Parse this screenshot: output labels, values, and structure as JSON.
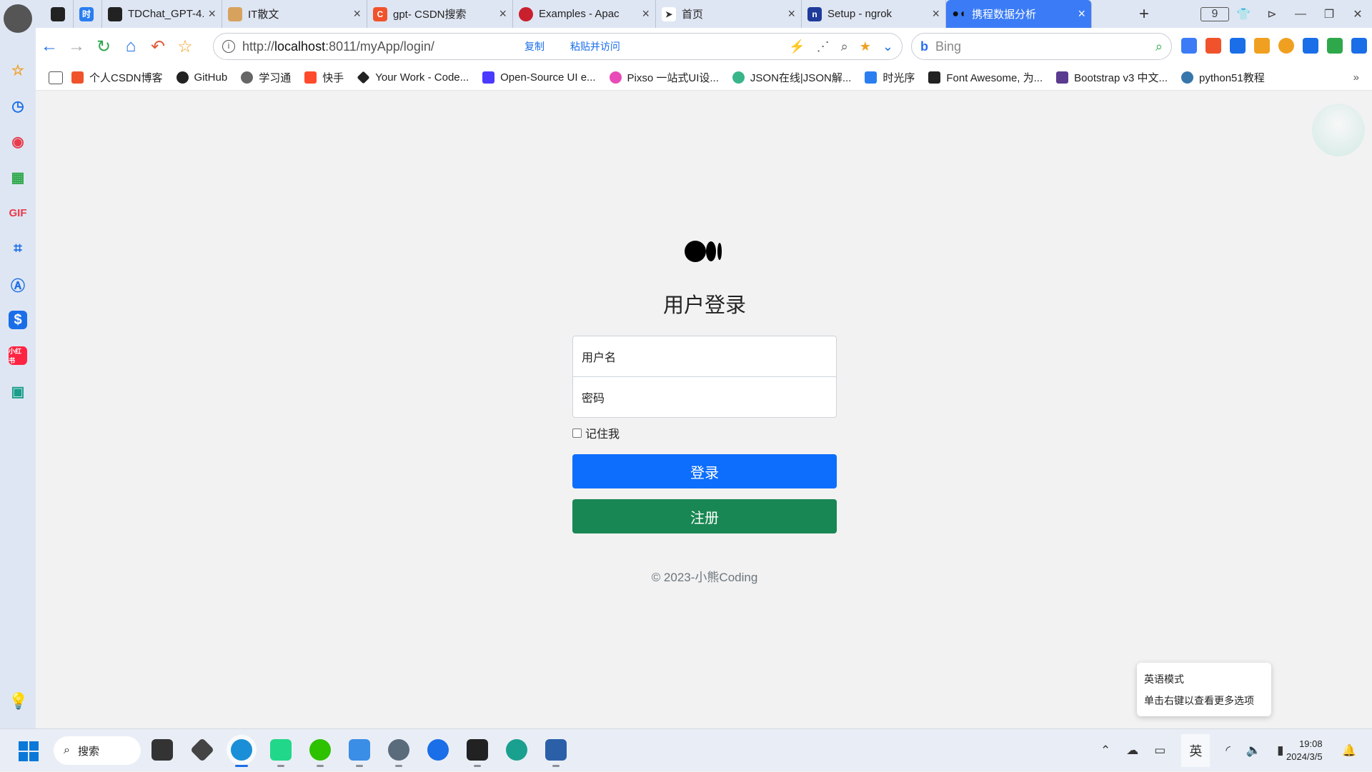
{
  "tabs": [
    {
      "title": "",
      "icon": "openai-icon",
      "color": "#222222"
    },
    {
      "title": "",
      "icon": "timeline-icon",
      "color": "#2a7ef0"
    },
    {
      "title": "TDChat_GPT-4...",
      "icon": "openai-icon",
      "color": "#222222"
    },
    {
      "title": "IT散文",
      "icon": "cat-icon",
      "color": "#d7a25e"
    },
    {
      "title": "gpt- CSDN搜索",
      "icon": "csdn-icon",
      "color": "#f0532b"
    },
    {
      "title": "Examples - Apac",
      "icon": "apache-icon",
      "color": "#c9202e"
    },
    {
      "title": "首页",
      "icon": "paper-plane-icon",
      "color": "#333333"
    },
    {
      "title": "Setup - ngrok",
      "icon": "ngrok-icon",
      "color": "#1f3b9a"
    },
    {
      "title": "携程数据分析",
      "icon": "medium-icon",
      "color": "#111111",
      "active": true
    }
  ],
  "tab_count": "9",
  "address": {
    "protocol": "http://",
    "host": "localhost",
    "path": ":8011/myApp/login/",
    "copy_label": "复制",
    "paste_label": "粘贴并访问"
  },
  "search": {
    "placeholder": "Bing",
    "engine_icon": "bing-icon"
  },
  "bookmarks": [
    {
      "label": "个人CSDN博客",
      "icon": "csdn-icon",
      "color": "#f0532b"
    },
    {
      "label": "GitHub",
      "icon": "github-icon",
      "color": "#222222"
    },
    {
      "label": "学习通",
      "icon": "globe-icon",
      "color": "#555555"
    },
    {
      "label": "快手",
      "icon": "kuaishou-icon",
      "color": "#ff4a2b"
    },
    {
      "label": "Your Work - Code...",
      "icon": "codepen-icon",
      "color": "#222222"
    },
    {
      "label": "Open-Source UI e...",
      "icon": "ui-icon",
      "color": "#4a3aff"
    },
    {
      "label": "Pixso 一站式UI设...",
      "icon": "pixso-icon",
      "color": "#e84ab8"
    },
    {
      "label": "JSON在线|JSON解...",
      "icon": "gear-icon",
      "color": "#39b58a"
    },
    {
      "label": "时光序",
      "icon": "timeline-icon",
      "color": "#2a7ef0"
    },
    {
      "label": "Font Awesome, 为...",
      "icon": "flag-icon",
      "color": "#222222"
    },
    {
      "label": "Bootstrap v3 中文...",
      "icon": "bootstrap-icon",
      "color": "#5a3b8f"
    },
    {
      "label": "python51教程",
      "icon": "python-icon",
      "color": "#3776ab"
    }
  ],
  "sidebar": [
    {
      "icon": "star-icon",
      "color": "#f0a020"
    },
    {
      "icon": "clock-icon",
      "color": "#1a6ee8"
    },
    {
      "icon": "record-icon",
      "color": "#e83a4a"
    },
    {
      "icon": "grid-icon",
      "color": "#2ea84b"
    },
    {
      "icon": "gif-icon",
      "color": "#e83a4a"
    },
    {
      "icon": "crop-icon",
      "color": "#1a6ee8"
    },
    {
      "icon": "text-recognition-icon",
      "color": "#1a6ee8"
    },
    {
      "icon": "dollar-app-icon",
      "color": "#1a6ee8"
    },
    {
      "icon": "xiaohongshu-icon",
      "color": "#ff2442",
      "label": "小红书"
    },
    {
      "icon": "monitor-icon",
      "color": "#1a9e8a"
    }
  ],
  "login": {
    "title": "用户登录",
    "username_placeholder": "用户名",
    "password_placeholder": "密码",
    "remember_label": "记住我",
    "login_button": "登录",
    "register_button": "注册",
    "copyright": "© 2023-小熊Coding",
    "login_color": "#0d6efd",
    "register_color": "#198754"
  },
  "tooltip": {
    "line1": "英语模式",
    "line2": "单击右键以查看更多选项"
  },
  "taskbar": {
    "search_label": "搜索",
    "apps": [
      {
        "icon": "file-explorer-icon",
        "color": "#333333"
      },
      {
        "icon": "unity-icon",
        "color": "#444444"
      },
      {
        "icon": "browser-icon",
        "color": "#1a8fd8",
        "active": true
      },
      {
        "icon": "pycharm-icon",
        "color": "#21d789"
      },
      {
        "icon": "wechat-icon",
        "color": "#2dc100"
      },
      {
        "icon": "notepad-icon",
        "color": "#3a8ee6"
      },
      {
        "icon": "settings-icon",
        "color": "#5a6b7c"
      },
      {
        "icon": "k-app-icon",
        "color": "#1a6ee8"
      },
      {
        "icon": "terminal-icon",
        "color": "#222222"
      },
      {
        "icon": "edge-icon",
        "color": "#1aa08f"
      },
      {
        "icon": "devcpp-icon",
        "color": "#2b5fa8"
      }
    ],
    "ime": "英",
    "time": "19:08",
    "date": "2024/3/5"
  }
}
